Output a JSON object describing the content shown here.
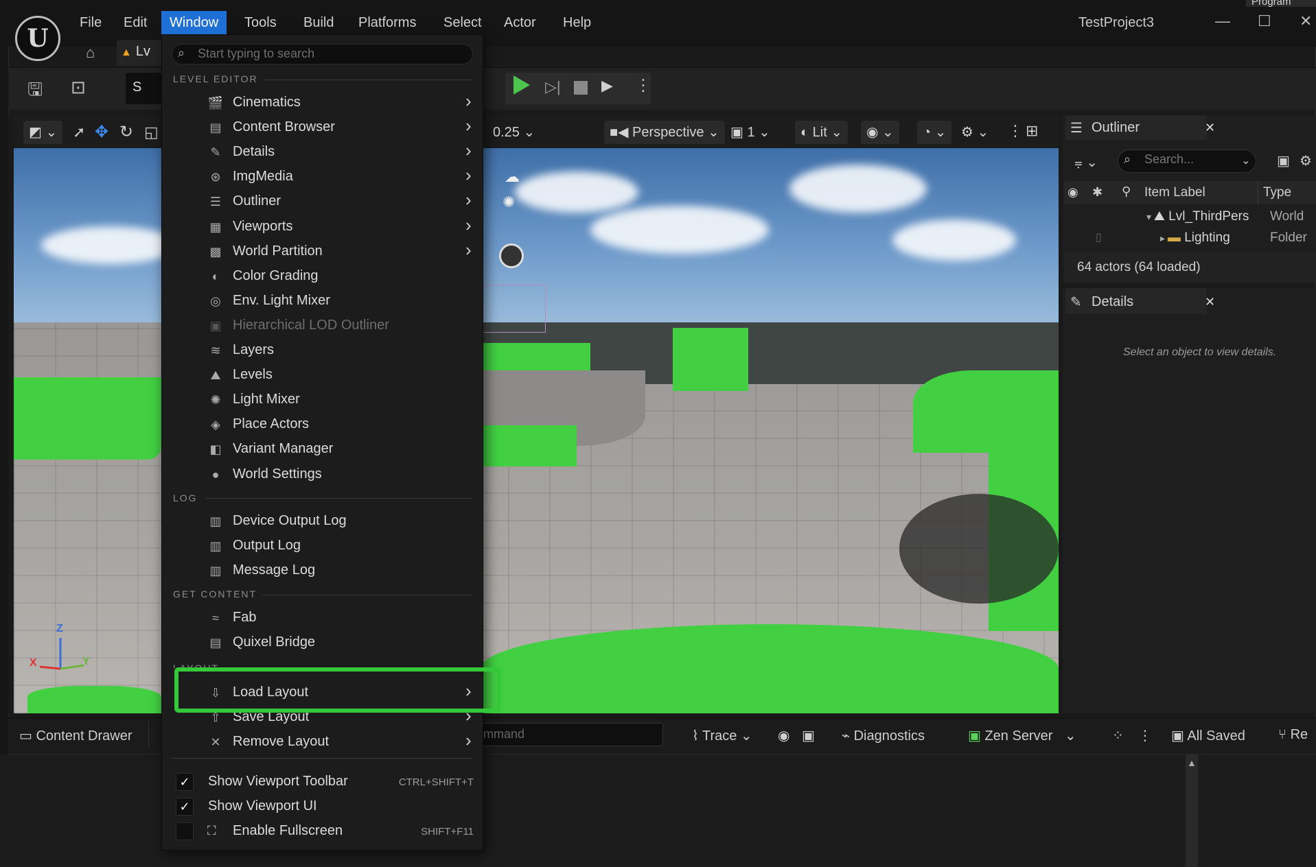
{
  "app": {
    "project_title": "TestProject3",
    "logo_glyph": "U"
  },
  "menubar": [
    "File",
    "Edit",
    "Window",
    "Tools",
    "Build",
    "Platforms",
    "Select",
    "Actor",
    "Help"
  ],
  "active_menu": "Window",
  "level_tab": {
    "label": "Lv"
  },
  "toolbar": {
    "select_label": "S"
  },
  "viewport": {
    "snap_value": "0.25",
    "view_mode": "Perspective",
    "camera_count": "1",
    "lighting_mode": "Lit",
    "axis": {
      "x": "X",
      "y": "Y",
      "z": "Z"
    }
  },
  "outliner": {
    "title": "Outliner",
    "search_placeholder": "Search...",
    "columns": [
      "Item Label",
      "Type"
    ],
    "rows": [
      {
        "label": "Lvl_ThirdPers",
        "type": "World"
      },
      {
        "label": "Lighting",
        "type": "Folder"
      }
    ],
    "status": "64 actors (64 loaded)"
  },
  "details": {
    "title": "Details",
    "empty_message": "Select an object to view details."
  },
  "statusbar": {
    "content_drawer": "Content Drawer",
    "cmd_placeholder": "mmand",
    "trace": "Trace",
    "diagnostics": "Diagnostics",
    "zen_server": "Zen Server",
    "all_saved": "All Saved",
    "revision": "Re"
  },
  "window_menu": {
    "search_placeholder": "Start typing to search",
    "sections": {
      "level_editor": "LEVEL EDITOR",
      "log": "LOG",
      "get_content": "GET CONTENT",
      "layout": "LAYOUT"
    },
    "level_editor_items": [
      {
        "label": "Cinematics",
        "icon": "clapper-icon",
        "glyph": "🎬",
        "submenu": true
      },
      {
        "label": "Content Browser",
        "icon": "content-browser-icon",
        "glyph": "▤",
        "submenu": true
      },
      {
        "label": "Details",
        "icon": "details-icon",
        "glyph": "✎",
        "submenu": true
      },
      {
        "label": "ImgMedia",
        "icon": "film-reel-icon",
        "glyph": "⊛",
        "submenu": true
      },
      {
        "label": "Outliner",
        "icon": "outliner-icon",
        "glyph": "☰",
        "submenu": true
      },
      {
        "label": "Viewports",
        "icon": "viewports-icon",
        "glyph": "▦",
        "submenu": true
      },
      {
        "label": "World Partition",
        "icon": "world-partition-icon",
        "glyph": "▩",
        "submenu": true
      },
      {
        "label": "Color Grading",
        "icon": "color-grading-icon",
        "glyph": "◐",
        "submenu": false
      },
      {
        "label": "Env. Light Mixer",
        "icon": "env-light-mixer-icon",
        "glyph": "◎",
        "submenu": false
      },
      {
        "label": "Hierarchical LOD Outliner",
        "icon": "hlod-icon",
        "glyph": "▣",
        "submenu": false,
        "disabled": true
      },
      {
        "label": "Layers",
        "icon": "layers-icon",
        "glyph": "≋",
        "submenu": false
      },
      {
        "label": "Levels",
        "icon": "levels-icon",
        "glyph": "⛰",
        "submenu": false
      },
      {
        "label": "Light Mixer",
        "icon": "light-mixer-icon",
        "glyph": "✺",
        "submenu": false
      },
      {
        "label": "Place Actors",
        "icon": "place-actors-icon",
        "glyph": "◈",
        "submenu": false
      },
      {
        "label": "Variant Manager",
        "icon": "variant-manager-icon",
        "glyph": "◧",
        "submenu": false
      },
      {
        "label": "World Settings",
        "icon": "globe-icon",
        "glyph": "●",
        "submenu": false
      }
    ],
    "log_items": [
      {
        "label": "Device Output Log",
        "icon": "log-icon",
        "glyph": "▥"
      },
      {
        "label": "Output Log",
        "icon": "log-icon",
        "glyph": "▥"
      },
      {
        "label": "Message Log",
        "icon": "log-icon",
        "glyph": "▥"
      }
    ],
    "get_content_items": [
      {
        "label": "Fab",
        "icon": "fab-icon",
        "glyph": "≈"
      },
      {
        "label": "Quixel Bridge",
        "icon": "quixel-icon",
        "glyph": "▤"
      }
    ],
    "layout_items": [
      {
        "label": "Load Layout",
        "icon": "load-layout-icon",
        "glyph": "⇩"
      },
      {
        "label": "Save Layout",
        "icon": "save-layout-icon",
        "glyph": "⇧"
      },
      {
        "label": "Remove Layout",
        "icon": "remove-layout-icon",
        "glyph": "✕"
      }
    ],
    "toggles": [
      {
        "label": "Show Viewport Toolbar",
        "shortcut": "CTRL+SHIFT+T",
        "checked": true
      },
      {
        "label": "Show Viewport UI",
        "shortcut": "",
        "checked": true
      },
      {
        "label": "Enable Fullscreen",
        "shortcut": "SHIFT+F11",
        "checked": false
      }
    ],
    "highlight_color": "#35c83a"
  },
  "corner_label": "Program"
}
